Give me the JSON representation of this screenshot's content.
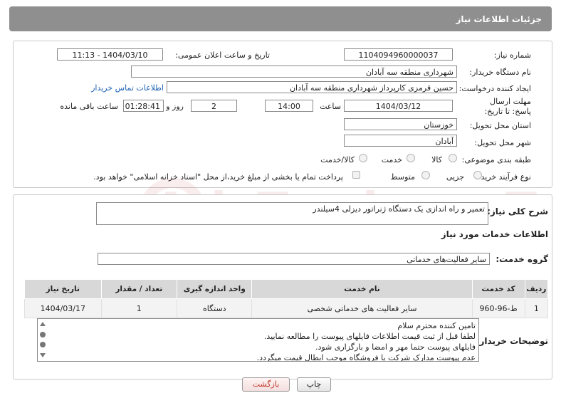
{
  "header": {
    "title": "جزئیات اطلاعات نیاز"
  },
  "form": {
    "need_number_label": "شماره نیاز:",
    "need_number": "1104094960000037",
    "announce_label": "تاریخ و ساعت اعلان عمومی:",
    "announce_value": "1404/03/10 - 11:13",
    "buyer_org_label": "نام دستگاه خریدار:",
    "buyer_org": "شهرداری منطقه سه آبادان",
    "creator_label": "ایجاد کننده درخواست:",
    "creator": "حسین قرمزی کارپرداز شهرداری منطقه سه آبادان",
    "contact_link": "اطلاعات تماس خریدار",
    "deadline_label": "مهلت ارسال پاسخ: تا تاریخ:",
    "deadline_date": "1404/03/12",
    "time_label": "ساعت",
    "deadline_time": "14:00",
    "days_label": "روز و",
    "days_value": "2",
    "remaining_time": "01:28:41",
    "remaining_label": "ساعت باقی مانده",
    "province_label": "استان محل تحویل:",
    "province": "خوزستان",
    "city_label": "شهر محل تحویل:",
    "city": "آبادان",
    "category_label": "طبقه بندی موضوعی:",
    "category_options": [
      "کالا",
      "خدمت",
      "کالا/خدمت"
    ],
    "process_label": "نوع فرآیند خرید :",
    "process_options": [
      "جزیی",
      "متوسط"
    ],
    "payment_note": "پرداخت تمام یا بخشی از مبلغ خرید،از محل \"اسناد خزانه اسلامی\" خواهد بود."
  },
  "summary": {
    "label": "شرح کلی نیاز:",
    "value": "تعمیر و راه اندازی یک دستگاه ژنراتور دیزلی 4سیلندر"
  },
  "services": {
    "section_title": "اطلاعات خدمات مورد نیاز",
    "group_label": "گروه خدمت:",
    "group_value": "سایر فعالیت‌های خدماتی",
    "columns": [
      "ردیف",
      "کد خدمت",
      "نام خدمت",
      "واحد اندازه گیری",
      "تعداد / مقدار",
      "تاریخ نیاز"
    ],
    "rows": [
      {
        "index": "1",
        "code": "ط-96-960",
        "name": "سایر فعالیت های خدماتی شخصی",
        "unit": "دستگاه",
        "qty": "1",
        "date": "1404/03/17"
      }
    ]
  },
  "notes": {
    "label": "توضیحات خریدار:",
    "lines": [
      "تامین کننده محترم سلام",
      "لطفا قبل از ثبت قیمت اطلاعات فایلهای پیوست را مطالعه نمایید.",
      "فایلهای پیوست حتما مهر و امضا و بارگزاری شود.",
      "عدم پیوست مدارک شرکت یا فروشگاه موجب ابطال قیمت میگردد."
    ]
  },
  "buttons": {
    "print": "چاپ",
    "back": "بازگشت"
  },
  "watermark": {
    "text": "AriaTender.neT"
  }
}
